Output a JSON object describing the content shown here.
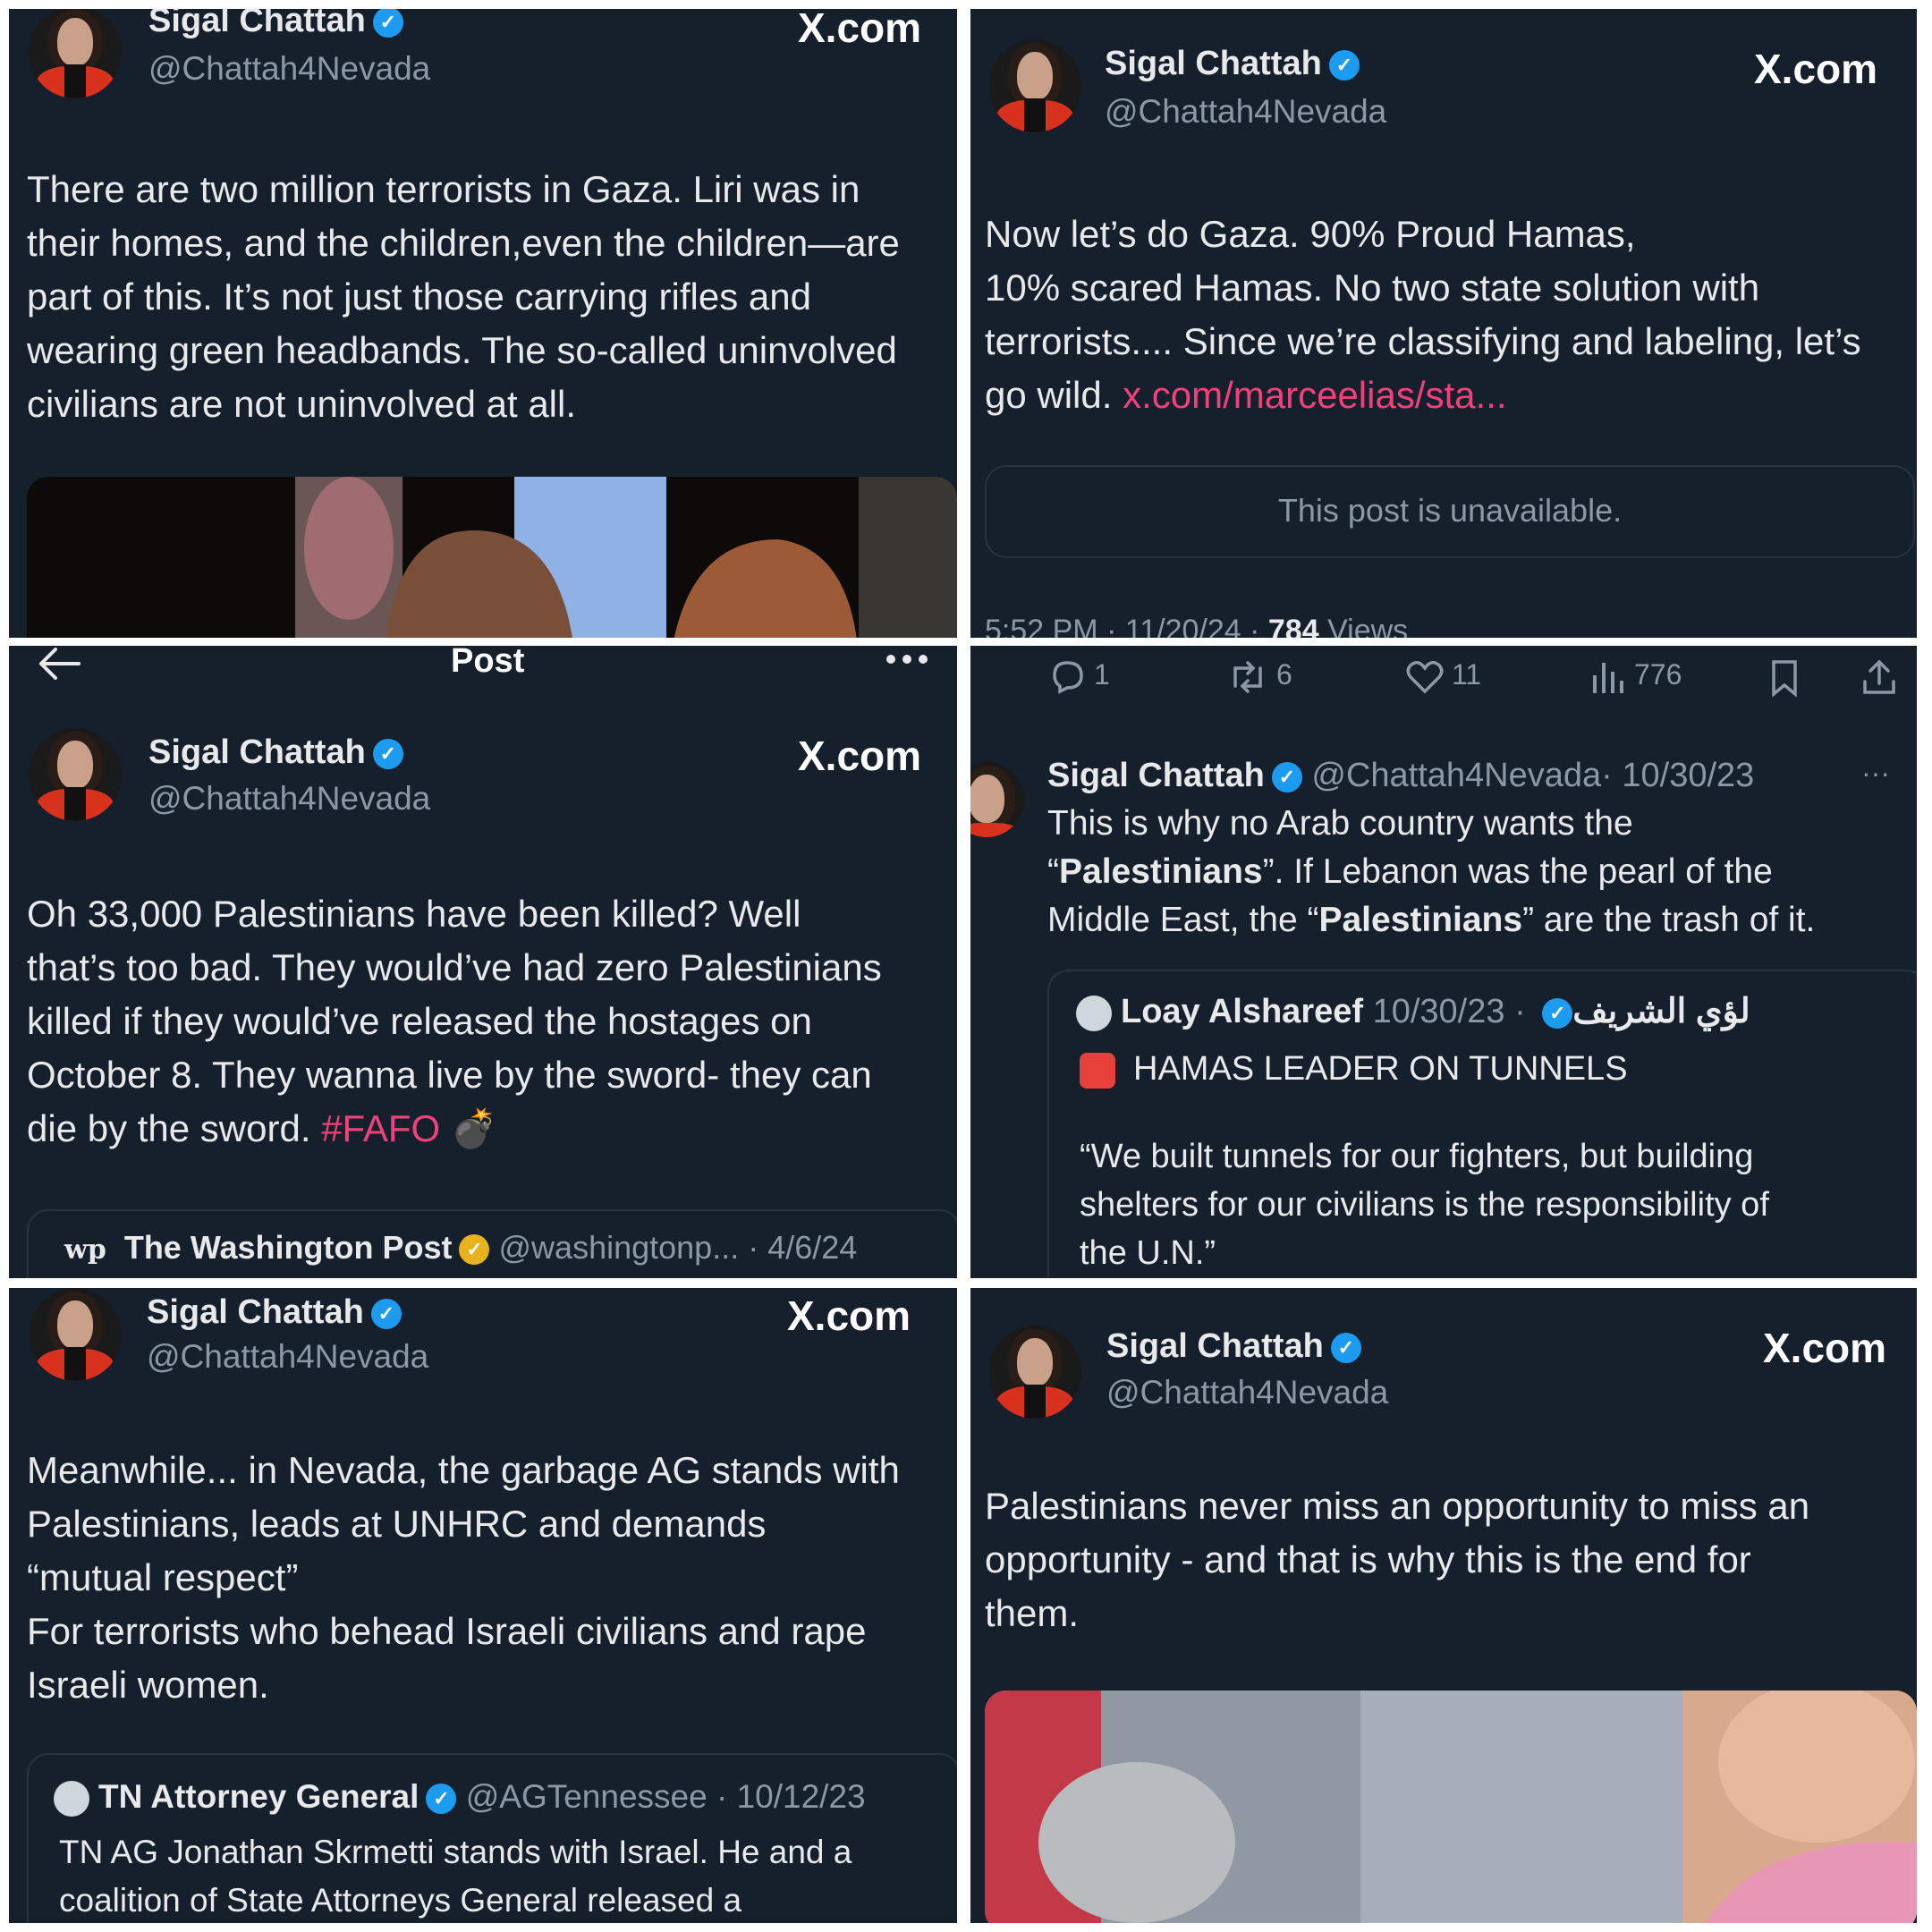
{
  "brand": "X.com",
  "p1": {
    "name": "Sigal Chattah",
    "handle": "@Chattah4Nevada",
    "lines": [
      "There are two million terrorists in Gaza. Liri was in",
      "their homes, and the children,even the children—are",
      "part of this. It’s not just those carrying rifles and",
      "wearing green headbands. The so-called uninvolved",
      "civilians are not uninvolved at all."
    ]
  },
  "p2": {
    "name": "Sigal Chattah",
    "handle": "@Chattah4Nevada",
    "lines": [
      "Now let’s do Gaza. 90% Proud Hamas,",
      "10% scared Hamas. No two state solution with",
      "terrorists.... Since we’re classifying and labeling, let’s"
    ],
    "last_line": "go wild.",
    "link": "x.com/marceelias/sta...",
    "unavailable": "This post is unavailable.",
    "timestamp": "5:52 PM · 11/20/24 ·",
    "views_count": "784",
    "views_label": "Views"
  },
  "p3": {
    "header_title": "Post",
    "name": "Sigal Chattah",
    "handle": "@Chattah4Nevada",
    "lines": [
      "Oh 33,000 Palestinians have been killed? Well",
      "that’s too bad. They would’ve had zero Palestinians",
      "killed if they would’ve released the hostages on",
      "October 8. They wanna live by the sword- they can"
    ],
    "last_line": "die by the sword.",
    "hashtag": "#FAFO",
    "emoji": "💣",
    "quote_logo": "wp",
    "quote_name": "The Washington Post",
    "quote_handle": "@washingtonp...",
    "quote_date": "· 4/6/24"
  },
  "p4": {
    "stats": {
      "replies": "1",
      "reposts": "6",
      "likes": "11",
      "views": "776"
    },
    "name": "Sigal Chattah",
    "handle": "@Chattah4Nevada",
    "date": "· 10/30/23",
    "more": "···",
    "line1": "This is why no Arab country wants the",
    "line2_open": "“",
    "line2_bold": "Palestinians",
    "line2_rest": "”. If Lebanon was the pearl of the",
    "line3_pre": "Middle East, the “",
    "line3_bold": "Palestinians",
    "line3_rest": "” are the trash of it.",
    "quote_name": "Loay Alshareef لؤي الشريف",
    "quote_date": "· 10/30/23",
    "quote_headline": "HAMAS LEADER ON TUNNELS",
    "quote_lines": [
      "“We built tunnels for our fighters, but building",
      "shelters for our civilians is the responsibility of",
      "the U.N.”"
    ]
  },
  "p5": {
    "name": "Sigal Chattah",
    "handle": "@Chattah4Nevada",
    "lines": [
      "Meanwhile... in Nevada, the garbage AG stands with",
      "Palestinians,  leads at UNHRC and demands",
      "“mutual respect”",
      "For terrorists who behead Israeli civilians and rape",
      "Israeli women."
    ],
    "quote_name": "TN Attorney General",
    "quote_handle": "@AGTennessee",
    "quote_date": "· 10/12/23",
    "quote_lines": [
      "TN AG Jonathan Skrmetti stands with Israel. He and a",
      "coalition of State Attorneys General released a"
    ]
  },
  "p6": {
    "name": "Sigal Chattah",
    "handle": "@Chattah4Nevada",
    "lines": [
      "Palestinians never miss an opportunity to miss an",
      "opportunity - and that is why this is the end for",
      "them."
    ]
  }
}
